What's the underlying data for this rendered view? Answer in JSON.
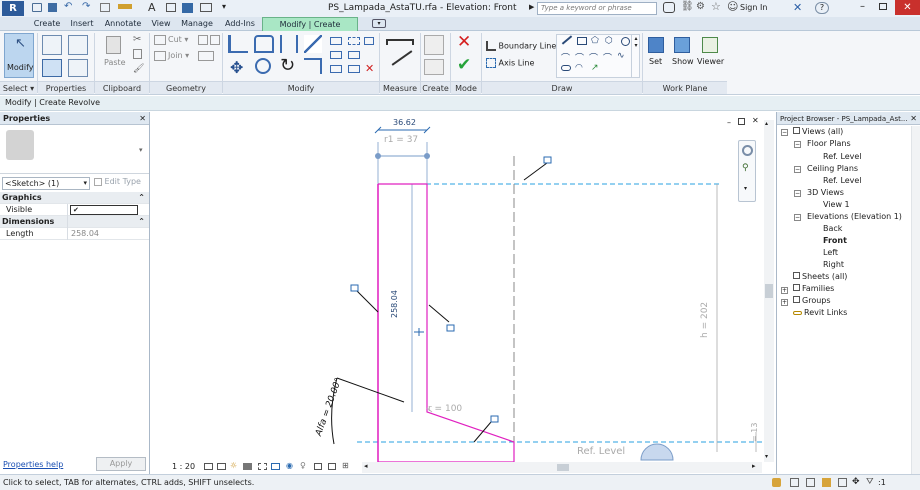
{
  "titlebar": {
    "app_icon": "R",
    "title": "PS_Lampada_AstaTU.rfa - Elevation: Front",
    "search_placeholder": "Type a keyword or phrase",
    "sign_in": "Sign In",
    "help": "?"
  },
  "tabs": [
    "Create",
    "Insert",
    "Annotate",
    "View",
    "Manage",
    "Add-Ins",
    "Modify | Create Revolve"
  ],
  "ribbon": {
    "modify_label": "Modify",
    "cut_label": "Cut",
    "paste_label": "Paste",
    "join_label": "Join",
    "boundary_line_label": "Boundary Line",
    "axis_line_label": "Axis Line",
    "set_label": "Set",
    "show_label": "Show",
    "viewer_label": "Viewer",
    "panels": [
      "Select",
      "Properties",
      "Clipboard",
      "Geometry",
      "Modify",
      "Measure",
      "Create",
      "Mode",
      "Draw",
      "Work Plane"
    ]
  },
  "context_bar": "Modify | Create Revolve",
  "properties": {
    "title": "Properties",
    "type_selector": "<Sketch> (1)",
    "edit_type": "Edit Type",
    "groups": [
      {
        "name": "Graphics",
        "rows": [
          {
            "label": "Visible",
            "value": "✔"
          }
        ]
      },
      {
        "name": "Dimensions",
        "rows": [
          {
            "label": "Length",
            "value": "258.04"
          }
        ]
      }
    ],
    "help_link": "Properties help",
    "apply_button": "Apply"
  },
  "drawing": {
    "dim_top": "36.62",
    "dim_r1": "r1 = 37",
    "dim_length": "258.04",
    "dim_h": "h = 202",
    "dim_r": "r = 100",
    "angle_label": "Alfa = 20.00°",
    "ref_level": "Ref. Level",
    "dim_13": "= 13",
    "scale": "1 : 20",
    "accent_color": "#e020c0",
    "ref_line_color": "#2aa0e0"
  },
  "browser": {
    "title": "Project Browser - PS_Lampada_Ast...",
    "tree": [
      {
        "label": "Views (all)",
        "level": 0,
        "bold": false
      },
      {
        "label": "Floor Plans",
        "level": 1,
        "bold": false
      },
      {
        "label": "Ref. Level",
        "level": 2,
        "bold": false
      },
      {
        "label": "Ceiling Plans",
        "level": 1,
        "bold": false
      },
      {
        "label": "Ref. Level",
        "level": 2,
        "bold": false
      },
      {
        "label": "3D Views",
        "level": 1,
        "bold": false
      },
      {
        "label": "View 1",
        "level": 2,
        "bold": false
      },
      {
        "label": "Elevations (Elevation 1)",
        "level": 1,
        "bold": false
      },
      {
        "label": "Back",
        "level": 2,
        "bold": false
      },
      {
        "label": "Front",
        "level": 2,
        "bold": true
      },
      {
        "label": "Left",
        "level": 2,
        "bold": false
      },
      {
        "label": "Right",
        "level": 2,
        "bold": false
      },
      {
        "label": "Sheets (all)",
        "level": 0,
        "bold": false
      },
      {
        "label": "Families",
        "level": 0,
        "bold": false
      },
      {
        "label": "Groups",
        "level": 0,
        "bold": false
      },
      {
        "label": "Revit Links",
        "level": 0,
        "bold": false
      }
    ]
  },
  "status": {
    "message": "Click to select, TAB for alternates, CTRL adds, SHIFT unselects.",
    "filter_count": ":1"
  }
}
